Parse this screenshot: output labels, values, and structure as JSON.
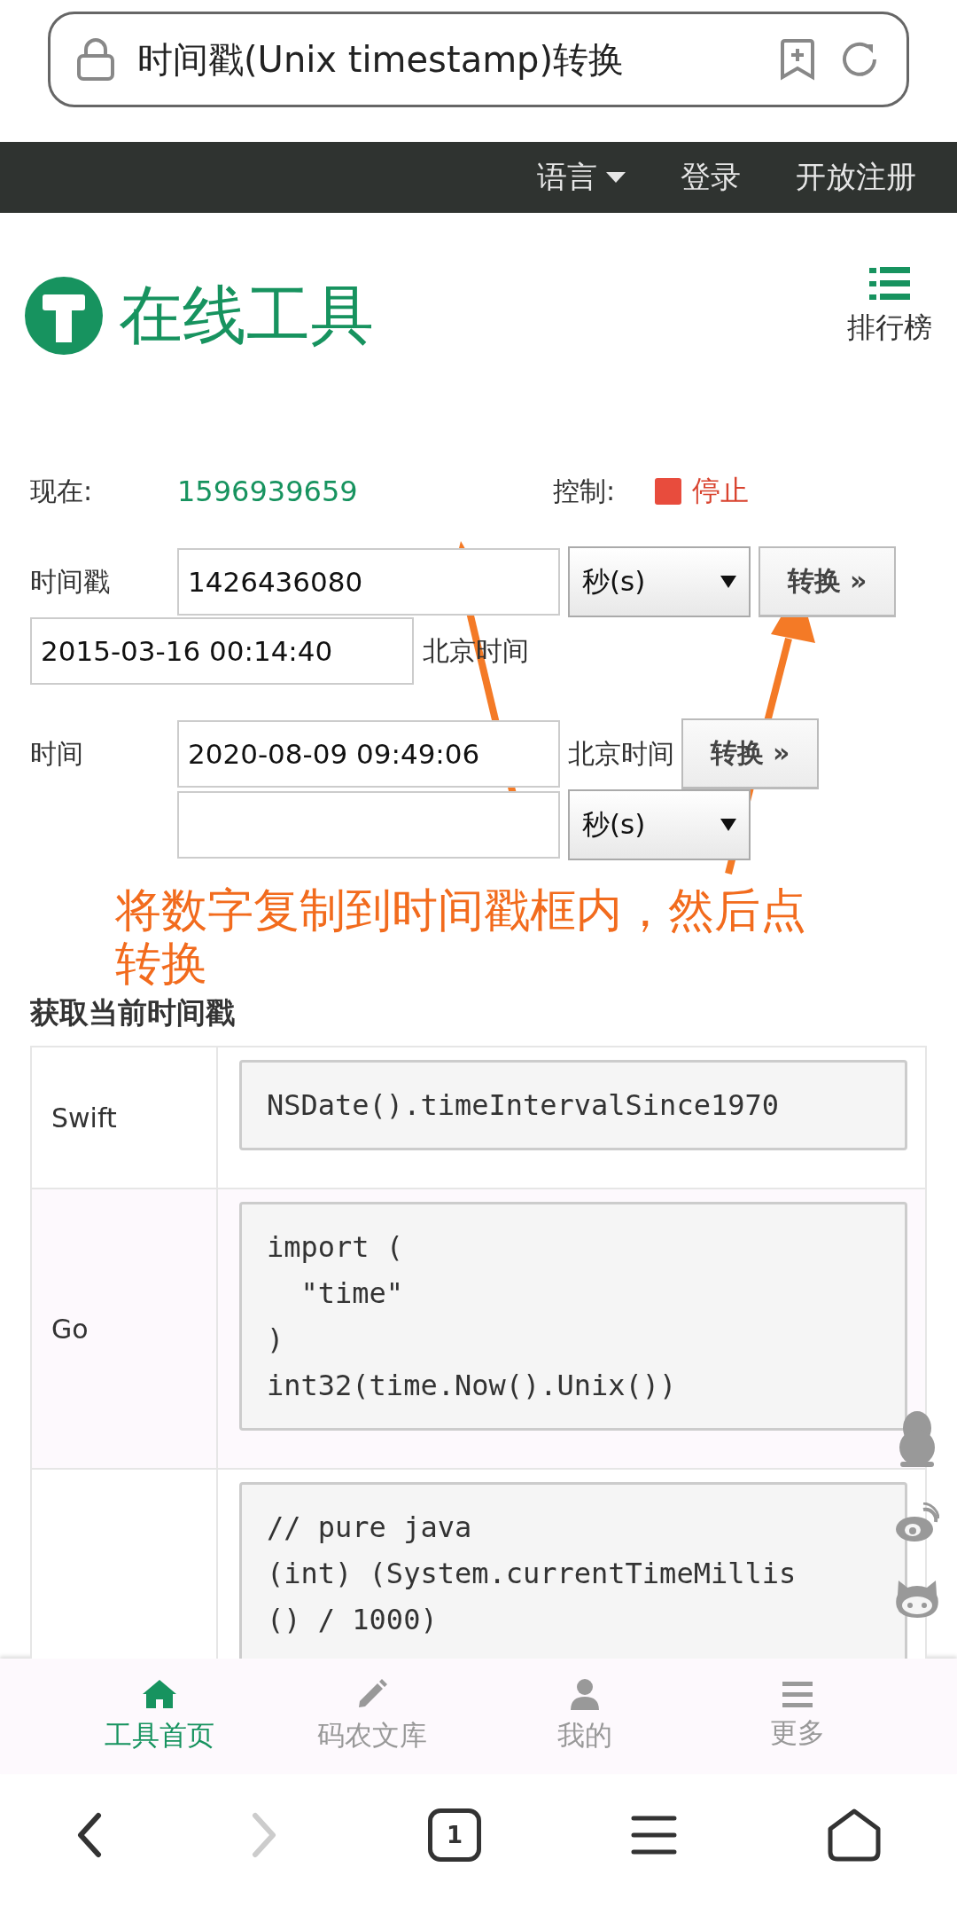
{
  "address_bar": {
    "title": "时间戳(Unix timestamp)转换"
  },
  "top_nav": {
    "items": [
      {
        "label": "语言",
        "kind": "dropdown"
      },
      {
        "label": "登录",
        "kind": "link"
      },
      {
        "label": "开放注册",
        "kind": "link"
      }
    ]
  },
  "header": {
    "logo_text": "在线工具",
    "ranking_label": "排行榜"
  },
  "now_row": {
    "label": "现在:",
    "timestamp": "1596939659",
    "control_label": "控制:",
    "stop_button": "停止"
  },
  "timestamp_row": {
    "label": "时间戳",
    "value": "1426436080",
    "unit": "秒(s)",
    "button": "转换 »",
    "result": "2015-03-16 00:14:40",
    "zone": "北京时间"
  },
  "time_row": {
    "label": "时间",
    "value": "2020-08-09 09:49:06",
    "zone": "北京时间",
    "button": "转换 »",
    "unit": "秒(s)"
  },
  "annotation": {
    "text": "将数字复制到时间戳框内，然后点转换"
  },
  "section_title": "获取当前时间戳",
  "code_table": {
    "rows": [
      {
        "language": "Swift",
        "code": [
          "NSDate().timeIntervalSince1970"
        ]
      },
      {
        "language": "Go",
        "code": [
          "import (",
          "  \"time\"",
          ")",
          "int32(time.Now().Unix())"
        ]
      },
      {
        "code": [
          "// pure java",
          "(int) (System.currentTimeMillis",
          "() / 1000)"
        ]
      }
    ]
  },
  "bottom_tabs": [
    {
      "label": "工具首页",
      "kind": "home",
      "selected": true
    },
    {
      "label": "码农文库",
      "kind": "pencil",
      "selected": false
    },
    {
      "label": "我的",
      "kind": "user",
      "selected": false
    },
    {
      "label": "更多",
      "kind": "menu",
      "selected": false
    }
  ],
  "browser_nav": {
    "back_disabled": false,
    "forward_disabled": true,
    "tab_count": "1"
  }
}
